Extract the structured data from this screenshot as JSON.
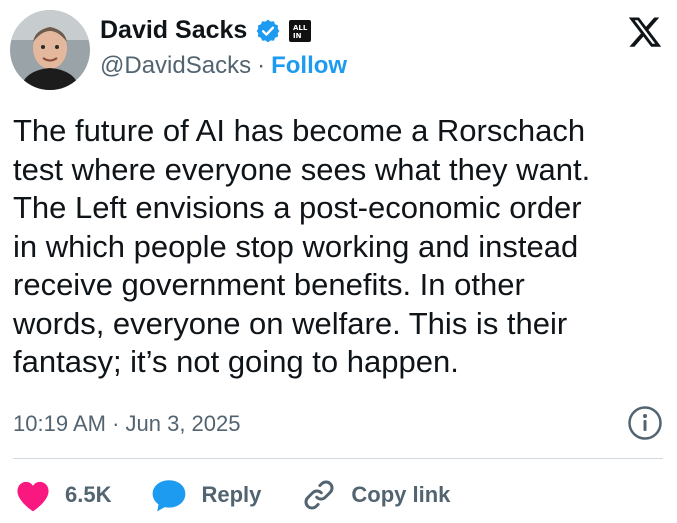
{
  "author": {
    "name": "David Sacks",
    "handle": "@DavidSacks",
    "follow_label": "Follow",
    "separator": "·",
    "affiliation_badge": "ALL IN"
  },
  "tweet": {
    "text": "The future of AI has become a Rorschach\ntest where everyone sees what they want.\nThe Left envisions a post-economic order\nin which people stop working and instead\nreceive government benefits. In other\nwords, everyone on welfare. This is their\nfantasy; it’s not going to happen.",
    "timestamp": "10:19 AM · Jun 3, 2025"
  },
  "actions": {
    "like_count": "6.5K",
    "reply_label": "Reply",
    "copy_link_label": "Copy link"
  },
  "icons": {
    "verified": "verified-badge-icon",
    "x_logo": "x-logo-icon",
    "info": "info-icon",
    "like": "heart-icon",
    "reply": "reply-bubble-icon",
    "copy_link": "link-icon"
  },
  "colors": {
    "accent": "#1d9bf0",
    "like": "#f91880",
    "text": "#0f1419",
    "muted": "#536471"
  }
}
